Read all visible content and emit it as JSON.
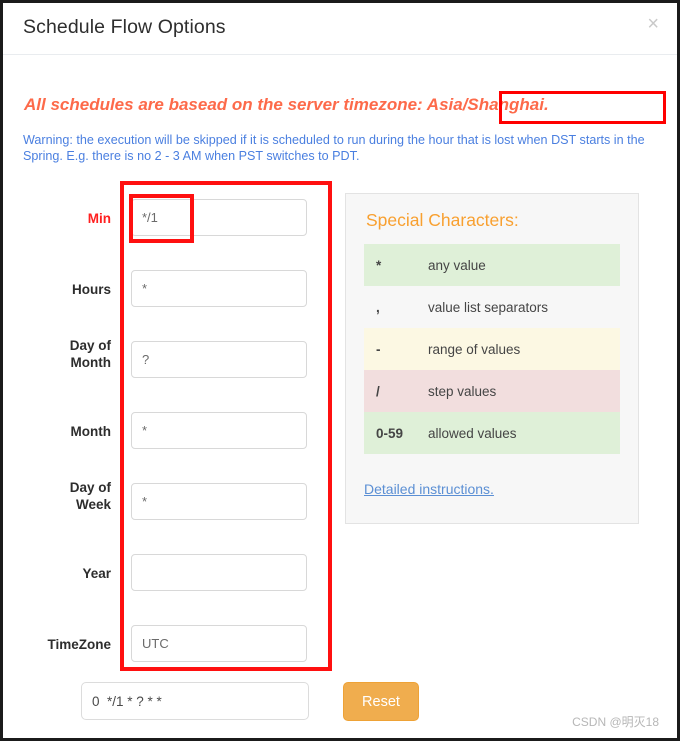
{
  "modal": {
    "title": "Schedule Flow Options",
    "close_label": "×"
  },
  "banner": {
    "prefix": "All schedules are basead on the server timezone: ",
    "timezone": "Asia/Shanghai.",
    "warning": "Warning: the execution will be skipped if it is scheduled to run during the hour that is lost when DST starts in the Spring. E.g. there is no 2 - 3 AM when PST switches to PDT."
  },
  "form": {
    "fields": [
      {
        "label": "Min",
        "value": "*/1",
        "placeholder": ""
      },
      {
        "label": "Hours",
        "value": "*",
        "placeholder": ""
      },
      {
        "label_line1": "Day of",
        "label_line2": "Month",
        "value": "?",
        "placeholder": ""
      },
      {
        "label": "Month",
        "value": "*",
        "placeholder": ""
      },
      {
        "label_line1": "Day of",
        "label_line2": "Week",
        "value": "*",
        "placeholder": ""
      },
      {
        "label": "Year",
        "value": "",
        "placeholder": ""
      },
      {
        "label": "TimeZone",
        "value": "UTC",
        "placeholder": ""
      }
    ]
  },
  "special": {
    "title": "Special Characters:",
    "rows": [
      {
        "symbol": "*",
        "description": "any value"
      },
      {
        "symbol": ",",
        "description": "value list separators"
      },
      {
        "symbol": "-",
        "description": "range of values"
      },
      {
        "symbol": "/",
        "description": "step values"
      },
      {
        "symbol": "0-59",
        "description": "allowed values"
      }
    ],
    "link_label": "Detailed instructions."
  },
  "footer": {
    "cron_expression": "0  */1 * ? * *",
    "reset_label": "Reset",
    "watermark": "CSDN @明灭18"
  },
  "colors": {
    "accent_orange": "#f8a030",
    "banner_orange": "#fd6a4a",
    "annotation_red": "#ff1010",
    "link_blue": "#5b8fd4",
    "warning_blue": "#4a7fe0",
    "reset_orange": "#f0ad4e",
    "row_green": "#dff0d8",
    "row_yellow": "#fcf8e3",
    "row_pink": "#f2dede"
  }
}
